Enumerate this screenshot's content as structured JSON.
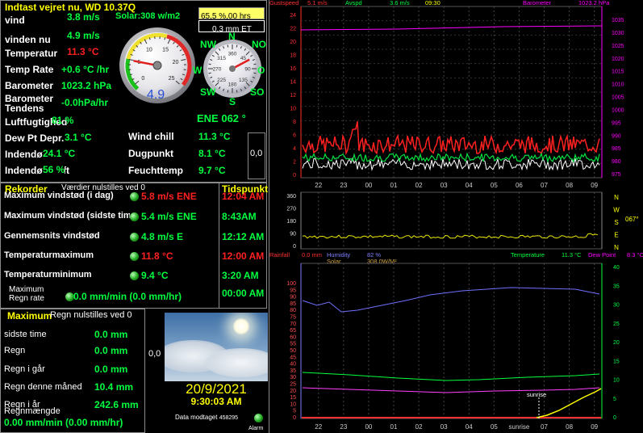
{
  "current": {
    "title": "Indtast vejret nu, WD 10.37Q",
    "solar_label": "Solar:308 w/m2",
    "humidity_box": "65,5 %,00 hrs",
    "et_box": "0,3 mm ET",
    "rows": [
      {
        "label": "vind",
        "value": "3.8 m/s"
      },
      {
        "label": "vinden nu",
        "value": "4.9 m/s"
      },
      {
        "label": "Temperatur",
        "value": "11.3 °C"
      },
      {
        "label": "Temp Rate",
        "value": "+0.6 °C /hr"
      },
      {
        "label": "Barometer",
        "value": "1023.2 hPa"
      },
      {
        "label": "Barometer Tendens",
        "value": "-0.0hPa/hr"
      },
      {
        "label": "Luftfugtighed",
        "value": "81 %"
      },
      {
        "label": "Dew Pt Depr.",
        "value": "3.1 °C"
      },
      {
        "label": "Indendørs temp",
        "value": "24.1 °C"
      },
      {
        "label": "Indendørs luftf",
        "value": "56 %"
      }
    ],
    "right_rows": [
      {
        "label": "Wind chill",
        "value": "11.3 °C"
      },
      {
        "label": "Dugpunkt",
        "value": "8.1 °C"
      },
      {
        "label": "Feuchttemp",
        "value": "9.7 °C"
      }
    ],
    "wind_dir_text": "ENE  062 °",
    "side_value": "0,0",
    "gauge_value": "4.9",
    "gauge_value_num": 4.9,
    "gauge_ticks": [
      "0",
      "5",
      "10",
      "15",
      "20",
      "25"
    ],
    "compass": {
      "N": "N",
      "NO": "NO",
      "NW": "NW",
      "W": "W",
      "O": "O",
      "SW": "SW",
      "SO": "SO",
      "S": "S",
      "heading": 62
    },
    "compass_ticks": [
      "360",
      "45",
      "90",
      "135",
      "180",
      "225",
      "270",
      "315"
    ]
  },
  "records": {
    "title": "Rekorder",
    "subtitle": "Værdier nulstilles ved 0",
    "time_title": "Tidspunkt",
    "rows": [
      {
        "label": "Maximum vindstød (i dag)",
        "value": "5.8 m/s ENE",
        "time": "12:04 AM",
        "red": true
      },
      {
        "label": "Maximum vindstød (sidste time)",
        "value": "5.4 m/s ENE",
        "time": "8:43AM",
        "red": false
      },
      {
        "label": "Gennemsnits vindstød",
        "value": "4.8 m/s   E",
        "time": "12:12 AM",
        "red": false
      },
      {
        "label": "Temperaturmaximum",
        "value": "11.8 °C",
        "time": "12:00 AM",
        "red": true
      },
      {
        "label": "Temperaturminimum",
        "value": "9.4 °C",
        "time": "3:20 AM",
        "red": false
      },
      {
        "label": "Maximum Regn rate",
        "value": "0.0 mm/min (0.0 mm/hr)",
        "time": "00:00 AM",
        "red": false
      }
    ]
  },
  "rain": {
    "title": "Maximum",
    "subtitle": "Regn nulstilles ved 0",
    "rows": [
      {
        "label": "sidste time",
        "value": "0.0 mm"
      },
      {
        "label": "Regn",
        "value": "0.0 mm"
      },
      {
        "label": "Regn i går",
        "value": "0.0 mm"
      },
      {
        "label": "Regn denne måned",
        "value": "10.4 mm"
      },
      {
        "label": "Regn i år",
        "value": "242.6 mm"
      }
    ],
    "rate_label": "Regnmængde",
    "rate_value": "0.00 mm/min (0.00 mm/hr)",
    "side_value": "0,0"
  },
  "status": {
    "date": "20/9/2021",
    "time": "9:30:03 AM",
    "data_received": "Data modtaget",
    "data_count": "458295",
    "alarm": "Alarm"
  },
  "graph1": {
    "legend": [
      "Gustspeed",
      "5.1 m/s",
      "Avspd",
      "3.6 m/s",
      "09:30",
      "Barometer",
      "1023.2 hPa"
    ],
    "left_ticks": [
      "24",
      "22",
      "20",
      "18",
      "16",
      "14",
      "12",
      "10",
      "8",
      "6",
      "4",
      "2",
      "0"
    ],
    "right_ticks": [
      "1035",
      "1030",
      "1025",
      "1020",
      "1015",
      "1010",
      "1005",
      "1000",
      "995",
      "990",
      "985",
      "980",
      "975"
    ],
    "x_labels": [
      "22",
      "23",
      "00",
      "01",
      "02",
      "03",
      "04",
      "05",
      "06",
      "07",
      "08",
      "09"
    ]
  },
  "graph2": {
    "left_ticks": [
      "360",
      "270",
      "180",
      "90",
      "0"
    ],
    "right_labels": [
      "N",
      "W",
      "S",
      "E",
      "N"
    ],
    "dir_value": "067°"
  },
  "graph3": {
    "legend_top": [
      "Rainfall",
      "0.0 mm",
      "Humidity",
      "82 %",
      "Temperature",
      "11.3 °C",
      "Dew Point",
      "8.3 °C"
    ],
    "legend_sub": [
      "Solar",
      "308.0W/M²"
    ],
    "left_ticks": [
      "100",
      "95",
      "90",
      "85",
      "80",
      "75",
      "70",
      "65",
      "60",
      "55",
      "50",
      "45",
      "40",
      "35",
      "30",
      "25",
      "20",
      "15",
      "10",
      "5",
      "0"
    ],
    "right_ticks": [
      "40",
      "35",
      "30",
      "25",
      "20",
      "15",
      "10",
      "5",
      "0"
    ],
    "x_labels": [
      "22",
      "23",
      "00",
      "01",
      "02",
      "03",
      "04",
      "05",
      "sunrise",
      "07",
      "08",
      "09"
    ],
    "sunrise_label": "sunrise"
  },
  "colors": {
    "accent_yellow": "#ffff00",
    "value_green": "#00ff40",
    "record_red": "#ff2020",
    "axis_magenta": "#ff00ff"
  }
}
